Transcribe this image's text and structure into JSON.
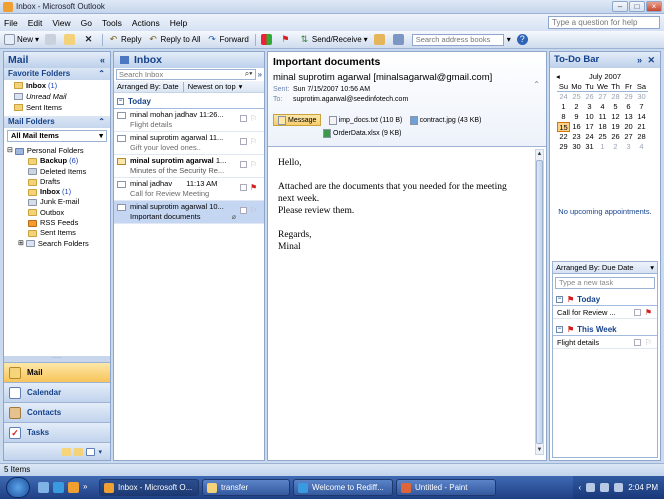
{
  "window": {
    "title": "Inbox - Microsoft Outlook",
    "help_placeholder": "Type a question for help"
  },
  "menu": [
    "File",
    "Edit",
    "View",
    "Go",
    "Tools",
    "Actions",
    "Help"
  ],
  "toolbar": {
    "new": "New",
    "reply": "Reply",
    "reply_all": "Reply to All",
    "forward": "Forward",
    "send_receive": "Send/Receive",
    "address_search": "Search address books"
  },
  "nav": {
    "header": "Mail",
    "favorites_header": "Favorite Folders",
    "favorites": [
      {
        "label": "Inbox",
        "count": "(1)"
      },
      {
        "label": "Unread Mail",
        "count": ""
      },
      {
        "label": "Sent Items",
        "count": ""
      }
    ],
    "mail_folders_header": "Mail Folders",
    "all_mail_items": "All Mail Items",
    "personal_folders": "Personal Folders",
    "folders": [
      {
        "label": "Backup",
        "count": "(6)",
        "bold": true
      },
      {
        "label": "Deleted Items",
        "count": ""
      },
      {
        "label": "Drafts",
        "count": ""
      },
      {
        "label": "Inbox",
        "count": "(1)",
        "bold": true
      },
      {
        "label": "Junk E-mail",
        "count": ""
      },
      {
        "label": "Outbox",
        "count": ""
      },
      {
        "label": "RSS Feeds",
        "count": ""
      },
      {
        "label": "Sent Items",
        "count": ""
      },
      {
        "label": "Search Folders",
        "count": ""
      }
    ],
    "buttons": {
      "mail": "Mail",
      "calendar": "Calendar",
      "contacts": "Contacts",
      "tasks": "Tasks"
    }
  },
  "inbox": {
    "header": "Inbox",
    "search_placeholder": "Search Inbox",
    "arranged_by": "Arranged By: Date",
    "sort": "Newest on top",
    "group": "Today",
    "messages": [
      {
        "from": "minal mohan jadhav",
        "time": "11:26...",
        "subject": "Flight details"
      },
      {
        "from": "minal suprotim agarwal",
        "time": "11...",
        "subject": "Gift your loved ones.."
      },
      {
        "from": "minal suprotim agarwal",
        "time": "1...",
        "subject": "Minutes of the Security Re..."
      },
      {
        "from": "minal jadhav",
        "time": "11:13 AM",
        "subject": "Call for Review Meeting"
      },
      {
        "from": "minal suprotim agarwal",
        "time": "10...",
        "subject": "Important documents"
      }
    ]
  },
  "reading": {
    "subject": "Important documents",
    "from": "minal suprotim agarwal [minalsagarwal@gmail.com]",
    "sent_label": "Sent:",
    "sent": "Sun 7/15/2007 10:56 AM",
    "to_label": "To:",
    "to": "suprotim.agarwal@seedinfotech.com",
    "message_tab": "Message",
    "attachments": [
      "imp_docs.txt (110 B)",
      "contract.jpg (43 KB)",
      "OrderData.xlsx (9 KB)"
    ],
    "body": {
      "greeting": "Hello,",
      "para1": "Attached are the documents that you needed for the meeting next week.",
      "para2": "Please review them.",
      "closing": "Regards,",
      "signature": "Minal"
    }
  },
  "todo": {
    "header": "To-Do Bar",
    "month": "July 2007",
    "dow": [
      "Su",
      "Mo",
      "Tu",
      "We",
      "Th",
      "Fr",
      "Sa"
    ],
    "weeks": [
      [
        [
          "24",
          "o"
        ],
        [
          "25",
          "o"
        ],
        [
          "26",
          "o"
        ],
        [
          "27",
          "o"
        ],
        [
          "28",
          "o"
        ],
        [
          "29",
          "o"
        ],
        [
          "30",
          "o"
        ]
      ],
      [
        [
          "1",
          ""
        ],
        [
          "2",
          ""
        ],
        [
          "3",
          ""
        ],
        [
          "4",
          ""
        ],
        [
          "5",
          ""
        ],
        [
          "6",
          ""
        ],
        [
          "7",
          ""
        ]
      ],
      [
        [
          "8",
          ""
        ],
        [
          "9",
          ""
        ],
        [
          "10",
          ""
        ],
        [
          "11",
          ""
        ],
        [
          "12",
          ""
        ],
        [
          "13",
          ""
        ],
        [
          "14",
          ""
        ]
      ],
      [
        [
          "15",
          "today"
        ],
        [
          "16",
          ""
        ],
        [
          "17",
          ""
        ],
        [
          "18",
          ""
        ],
        [
          "19",
          ""
        ],
        [
          "20",
          ""
        ],
        [
          "21",
          ""
        ]
      ],
      [
        [
          "22",
          ""
        ],
        [
          "23",
          ""
        ],
        [
          "24",
          ""
        ],
        [
          "25",
          ""
        ],
        [
          "26",
          ""
        ],
        [
          "27",
          ""
        ],
        [
          "28",
          ""
        ]
      ],
      [
        [
          "29",
          ""
        ],
        [
          "30",
          ""
        ],
        [
          "31",
          ""
        ],
        [
          "1",
          "o"
        ],
        [
          "2",
          "o"
        ],
        [
          "3",
          "o"
        ],
        [
          "4",
          "o"
        ]
      ]
    ],
    "no_appointments": "No upcoming appointments.",
    "arranged_by": "Arranged By: Due Date",
    "new_task_placeholder": "Type a new task",
    "groups": [
      {
        "label": "Today",
        "tasks": [
          "Call for Review ..."
        ]
      },
      {
        "label": "This Week",
        "tasks": [
          "Flight details"
        ]
      }
    ]
  },
  "status": "5 Items",
  "taskbar": {
    "tasks": [
      "Inbox - Microsoft O...",
      "transfer",
      "Welcome to Rediff...",
      "Untitled - Paint"
    ],
    "clock": "2:04 PM"
  },
  "colors": {
    "accent": "#15428b",
    "selected": "#c4d6f2",
    "flag": "#d31d1d",
    "today": "#fbd28a"
  }
}
